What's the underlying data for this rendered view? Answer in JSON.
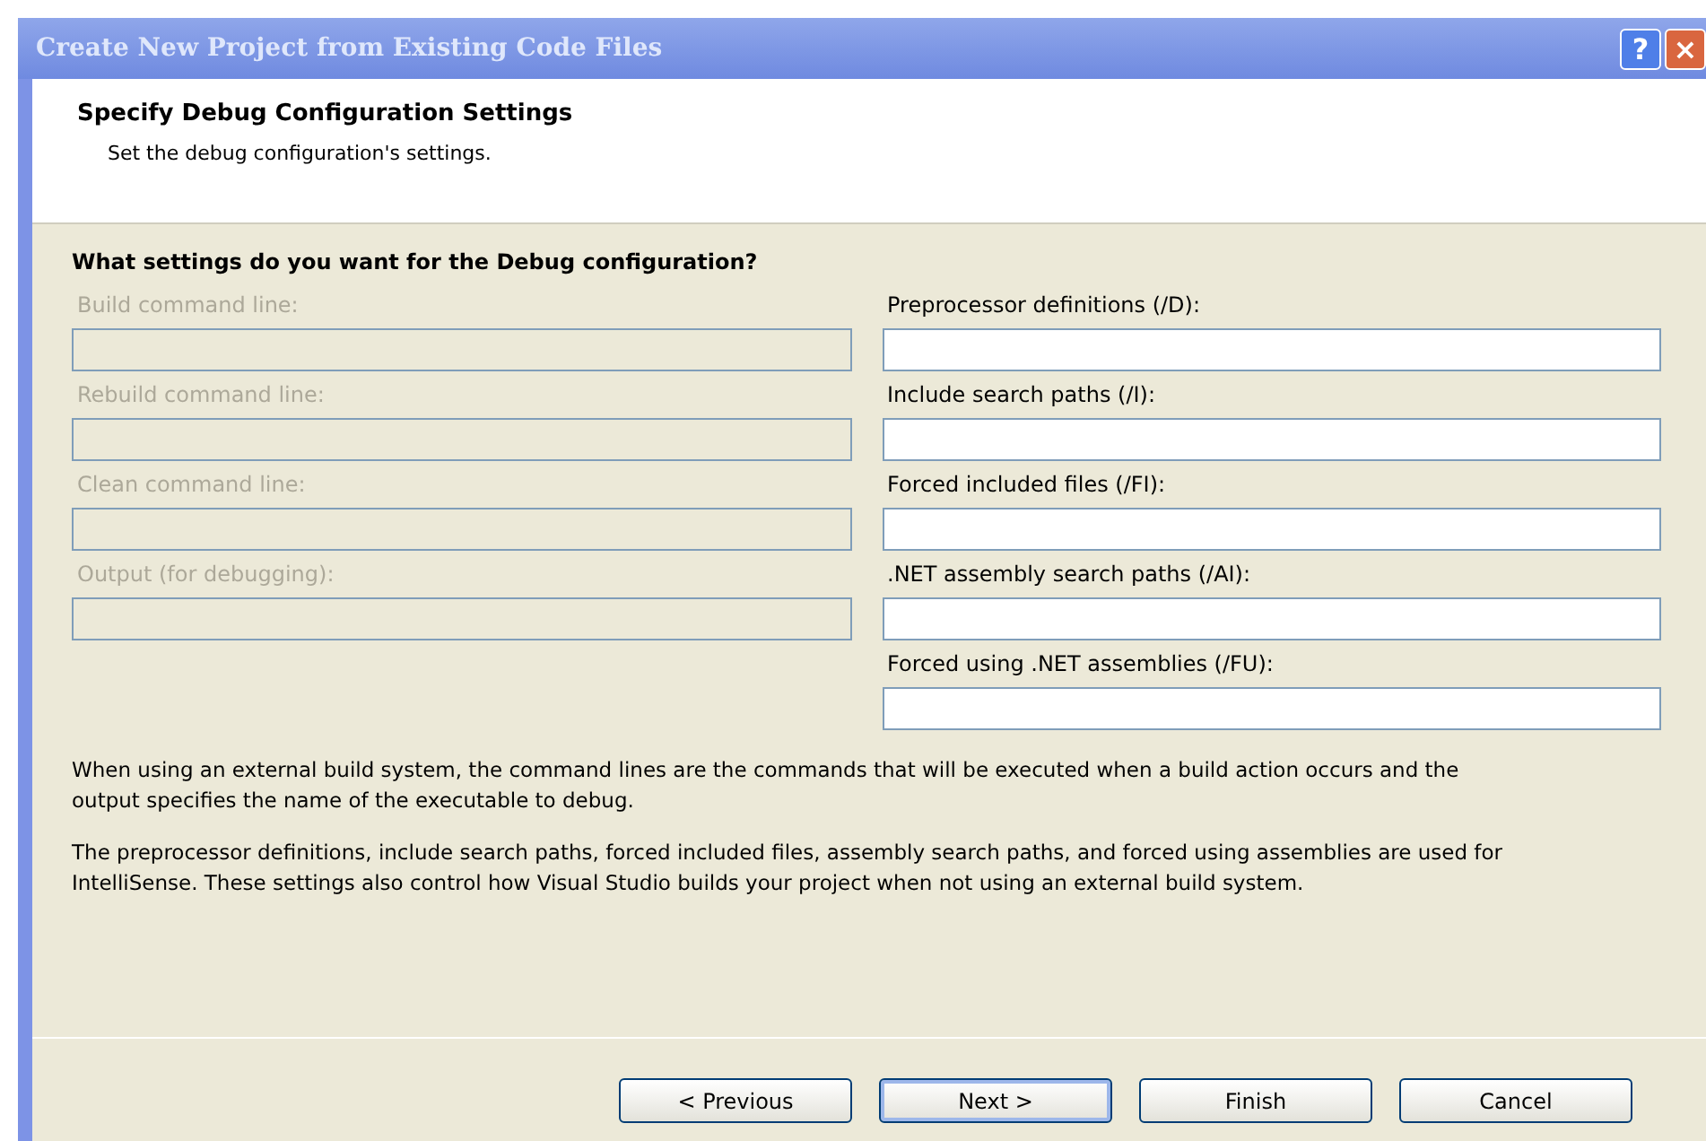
{
  "window": {
    "title": "Create New Project from Existing Code Files",
    "title_buttons": [
      "?",
      "×"
    ]
  },
  "header": {
    "title": "Specify Debug Configuration Settings",
    "subtitle": "Set the debug configuration's settings."
  },
  "question": "What settings do you want for the Debug configuration?",
  "left_fields": [
    {
      "label": "Build command line:",
      "disabled": true
    },
    {
      "label": "Rebuild command line:",
      "disabled": true
    },
    {
      "label": "Clean command line:",
      "disabled": true
    },
    {
      "label": "Output (for debugging):",
      "disabled": true
    }
  ],
  "right_fields": [
    {
      "label": "Preprocessor definitions (/D):",
      "disabled": false
    },
    {
      "label": "Include search paths (/I):",
      "disabled": false
    },
    {
      "label": "Forced included files (/FI):",
      "disabled": false
    },
    {
      "label": ".NET assembly search paths (/AI):",
      "disabled": false
    },
    {
      "label": "Forced using .NET assemblies (/FU):",
      "disabled": false
    }
  ],
  "notes": [
    "When using an external build system, the command lines are the commands that will be executed when a build action occurs and the output specifies the name of the executable to debug.",
    "The preprocessor definitions, include search paths, forced included files, assembly search paths, and forced using assemblies are used for IntelliSense.  These settings also control how Visual Studio builds your project when not using an external build system."
  ],
  "buttons": [
    {
      "label": "< Previous",
      "default": false
    },
    {
      "label": "Next >",
      "default": true
    },
    {
      "label": "Finish",
      "default": false
    },
    {
      "label": "Cancel",
      "default": false
    }
  ]
}
